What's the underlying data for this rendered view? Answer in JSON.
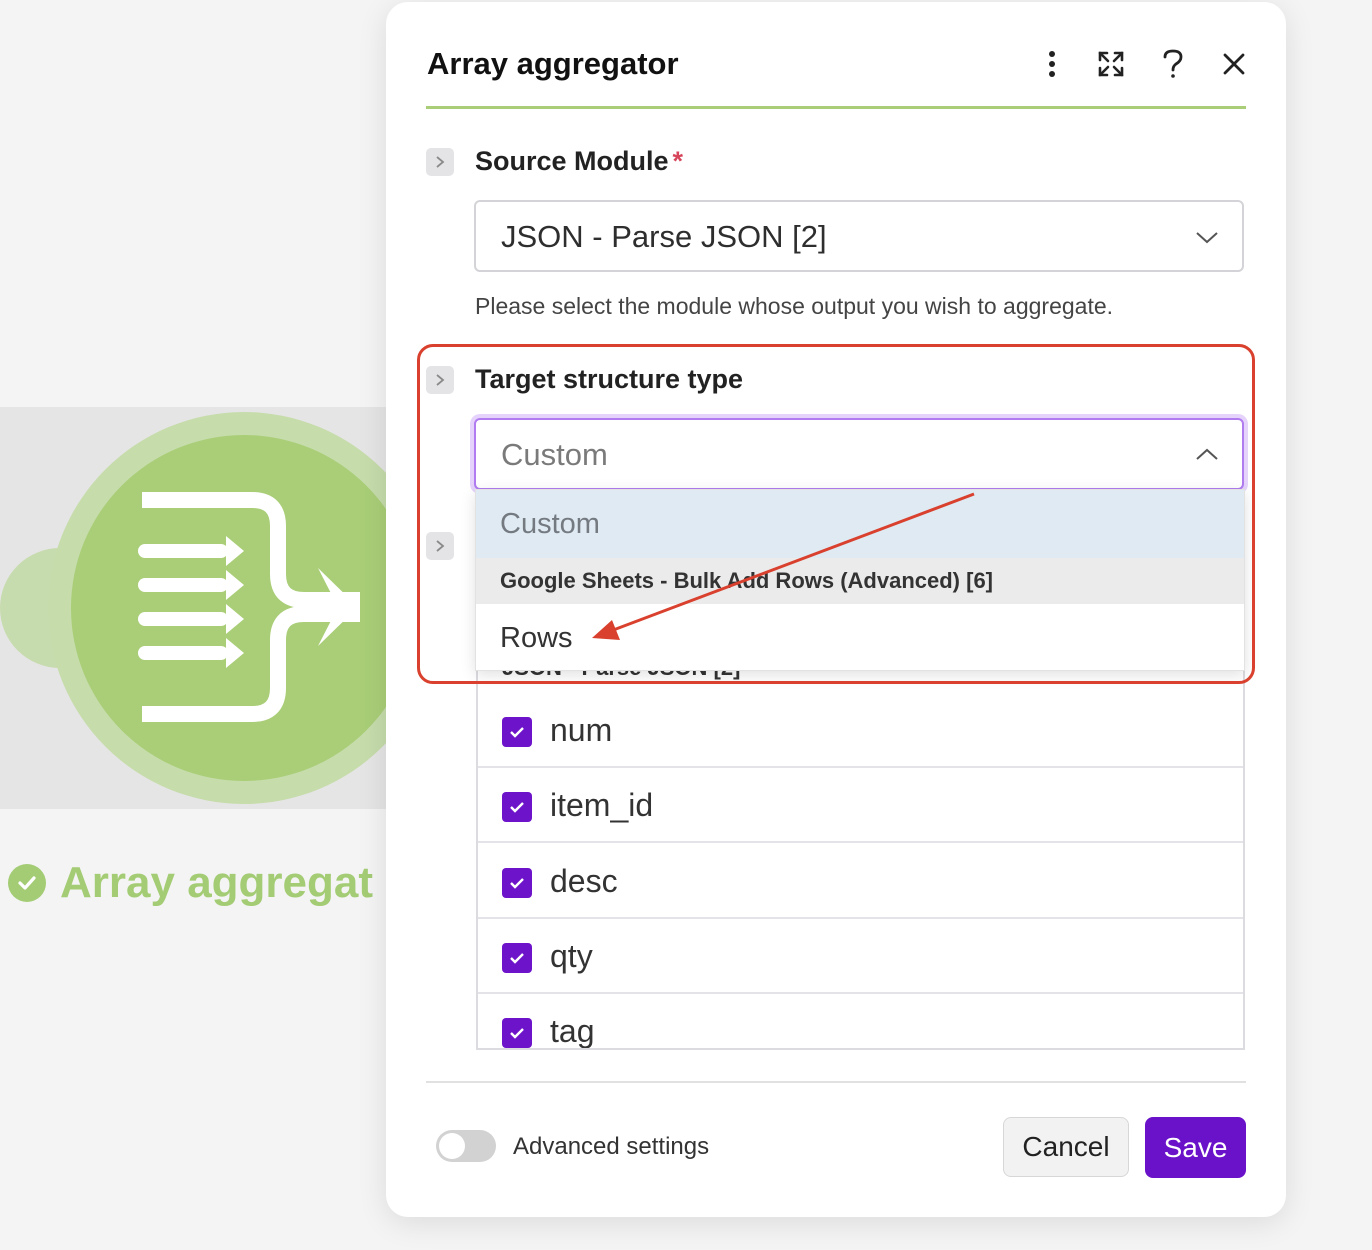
{
  "module": {
    "label": "Array aggregat",
    "accent": "#a9ce77"
  },
  "dialog": {
    "title": "Array aggregator",
    "header_icons": [
      "more-vertical-icon",
      "expand-icon",
      "help-icon",
      "close-icon"
    ],
    "source_module": {
      "label": "Source Module",
      "required_mark": "*",
      "value": "JSON - Parse JSON [2]",
      "help": "Please select the module whose output you wish to aggregate."
    },
    "target_structure": {
      "label": "Target structure type",
      "value": "Custom",
      "dropdown": {
        "selected_option": "Custom",
        "group_header": "Google Sheets - Bulk Add Rows (Advanced) [6]",
        "option": "Rows"
      }
    },
    "aggregated_fields": {
      "section_title_partial": "JSON - Parse JSON [2]",
      "items": [
        {
          "name": "num",
          "checked": true
        },
        {
          "name": "item_id",
          "checked": true
        },
        {
          "name": "desc",
          "checked": true
        },
        {
          "name": "qty",
          "checked": true
        },
        {
          "name": "tag",
          "checked": true
        }
      ]
    },
    "footer": {
      "advanced_settings_label": "Advanced settings",
      "advanced_settings_on": false,
      "cancel_label": "Cancel",
      "save_label": "Save"
    },
    "colors": {
      "brand_purple": "#6a12c9",
      "annotation_red": "#d9412e",
      "focus_purple": "#b07cf0"
    }
  }
}
